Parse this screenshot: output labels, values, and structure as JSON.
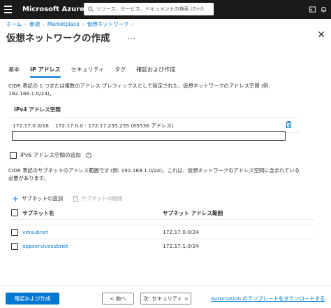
{
  "topbar": {
    "brand": "Microsoft Azure",
    "search_placeholder": "リソース、サービス、ドキュメントの検索 (G+/)",
    "bg_color": "#1b1a19"
  },
  "breadcrumb": {
    "items": [
      "ホーム",
      "新規",
      "Marketplace",
      "仮想ネットワーク"
    ]
  },
  "page": {
    "title": "仮想ネットワークの作成",
    "more": "…",
    "close": "✕"
  },
  "tabs": [
    {
      "label": "基本",
      "active": false
    },
    {
      "label": "IP アドレス",
      "active": true
    },
    {
      "label": "セキュリティ",
      "active": false
    },
    {
      "label": "タグ",
      "active": false
    },
    {
      "label": "確認および作成",
      "active": false
    }
  ],
  "ip_section": {
    "description_line1": "CIDR 表記の 1 つまたは複数のアドレス プレフィックスとして指定された、仮想ネットワークのアドレス空間 (例:",
    "description_line2": "192.168.1.0/24)。",
    "ipv4_header": "IPv4 アドレス空間",
    "address_space": {
      "cidr": "172.17.0.0/16",
      "range": "172.17.0.0 - 172.17.255.255 (65536 アドレス)"
    },
    "new_address_value": "",
    "ipv6_label": "IPv6 アドレス空間の追加",
    "ipv6_checked": false
  },
  "subnet_section": {
    "description_line1": "CIDR 表記のサブネットのアドレス範囲です (例: 192.168.1.0/24)。これは、仮想ネットワークのアドレス空間に含まれている",
    "description_line2": "必要があります。",
    "add_label": "サブネットの追加",
    "delete_label": "サブネットの削除",
    "columns": [
      "サブネット名",
      "サブネット アドレス範囲"
    ],
    "rows": [
      {
        "name": "vmsubnet",
        "range": "172.17.0.0/24"
      },
      {
        "name": "appservicesubnet",
        "range": "172.17.1.0/24"
      }
    ]
  },
  "footer": {
    "review_create": "確認および作成",
    "prev": "< 前へ",
    "next": "次: セキュリティ >",
    "download_link": "Automation のテンプレートをダウンロードする"
  },
  "colors": {
    "accent": "#0078d4",
    "text": "#323130",
    "border": "#edebe9"
  }
}
